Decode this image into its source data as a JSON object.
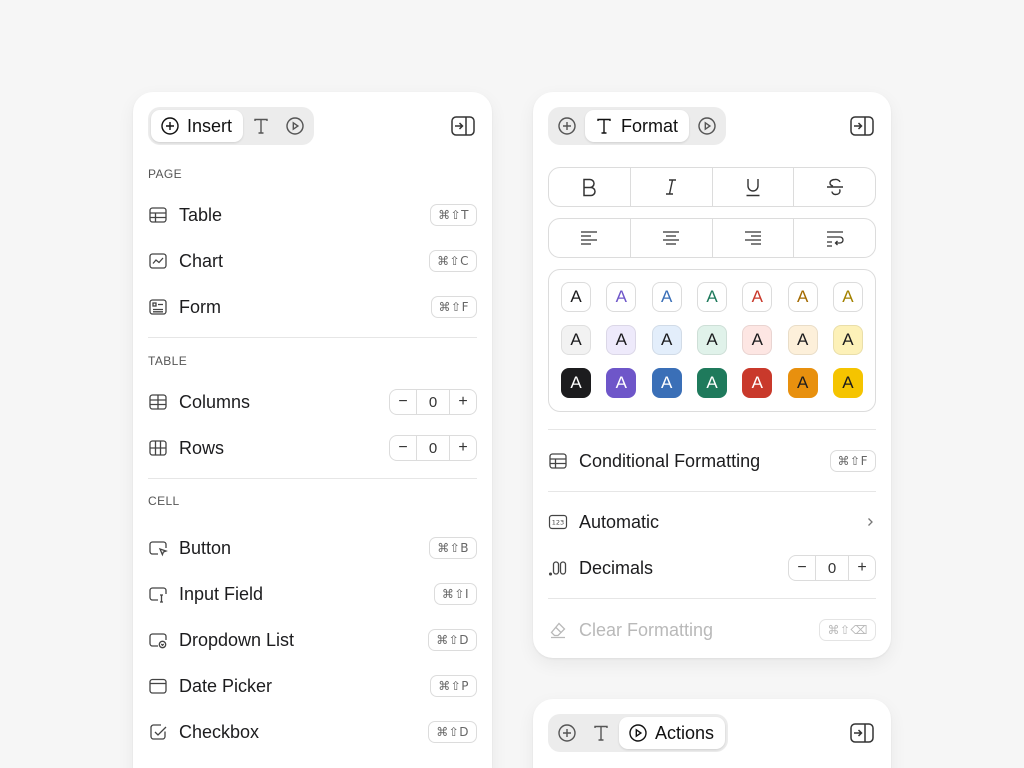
{
  "insert": {
    "tabs": [
      {
        "label": "Insert",
        "icon": "plus-circle-icon",
        "active": true
      },
      {
        "label": "",
        "icon": "type-icon",
        "active": false
      },
      {
        "label": "",
        "icon": "play-circle-icon",
        "active": false
      }
    ],
    "sections": {
      "page": "PAGE",
      "table": "TABLE",
      "cell": "CELL"
    },
    "page_items": [
      {
        "label": "Table",
        "icon": "table-icon",
        "shortcut": "⌘⇧T"
      },
      {
        "label": "Chart",
        "icon": "chart-icon",
        "shortcut": "⌘⇧C"
      },
      {
        "label": "Form",
        "icon": "form-icon",
        "shortcut": "⌘⇧F"
      }
    ],
    "table_items": [
      {
        "label": "Columns",
        "icon": "columns-icon",
        "value": "0",
        "minus": "−",
        "plus": "+"
      },
      {
        "label": "Rows",
        "icon": "rows-icon",
        "value": "0",
        "minus": "−",
        "plus": "+"
      }
    ],
    "cell_items": [
      {
        "label": "Button",
        "icon": "button-cursor-icon",
        "shortcut": "⌘⇧B"
      },
      {
        "label": "Input Field",
        "icon": "input-field-icon",
        "shortcut": "⌘⇧I"
      },
      {
        "label": "Dropdown List",
        "icon": "dropdown-icon",
        "shortcut": "⌘⇧D"
      },
      {
        "label": "Date Picker",
        "icon": "calendar-icon",
        "shortcut": "⌘⇧P"
      },
      {
        "label": "Checkbox",
        "icon": "checkbox-icon",
        "shortcut": "⌘⇧D"
      }
    ]
  },
  "format": {
    "tabs": [
      {
        "label": "",
        "icon": "plus-circle-icon",
        "active": false
      },
      {
        "label": "Format",
        "icon": "type-icon",
        "active": true
      },
      {
        "label": "",
        "icon": "play-circle-icon",
        "active": false
      }
    ],
    "style_buttons": [
      "bold-icon",
      "italic-icon",
      "underline-icon",
      "strikethrough-icon"
    ],
    "align_buttons": [
      "align-left-icon",
      "align-center-icon",
      "align-right-icon",
      "wrap-text-icon"
    ],
    "swatch_letter": "A",
    "swatch_colors": [
      "#1c1c1e",
      "#6e56c9",
      "#3a6fb7",
      "#1f7a5c",
      "#c9392b",
      "#e8900e",
      "#f5c400"
    ],
    "tint_colors": [
      "#f2f2f2",
      "#eeeafb",
      "#e3eefb",
      "#e0f2ea",
      "#fde6e3",
      "#fdf0da",
      "#fdf1b8"
    ],
    "text_colors": [
      "#1c1c1e",
      "#6e56c9",
      "#3a6fb7",
      "#1f7a5c",
      "#c9392b",
      "#a36a00",
      "#a38200"
    ],
    "conditional": {
      "label": "Conditional Formatting",
      "icon": "table-icon",
      "shortcut": "⌘⇧F"
    },
    "automatic": {
      "label": "Automatic",
      "icon": "number-format-icon"
    },
    "decimals": {
      "label": "Decimals",
      "icon": "decimals-icon",
      "value": "0",
      "minus": "−",
      "plus": "+"
    },
    "clear": {
      "label": "Clear Formatting",
      "icon": "eraser-icon",
      "shortcut": "⌘⇧⌫"
    }
  },
  "actions": {
    "tabs": [
      {
        "label": "",
        "icon": "plus-circle-icon",
        "active": false
      },
      {
        "label": "",
        "icon": "type-icon",
        "active": false
      },
      {
        "label": "Actions",
        "icon": "play-circle-icon",
        "active": true
      }
    ]
  }
}
